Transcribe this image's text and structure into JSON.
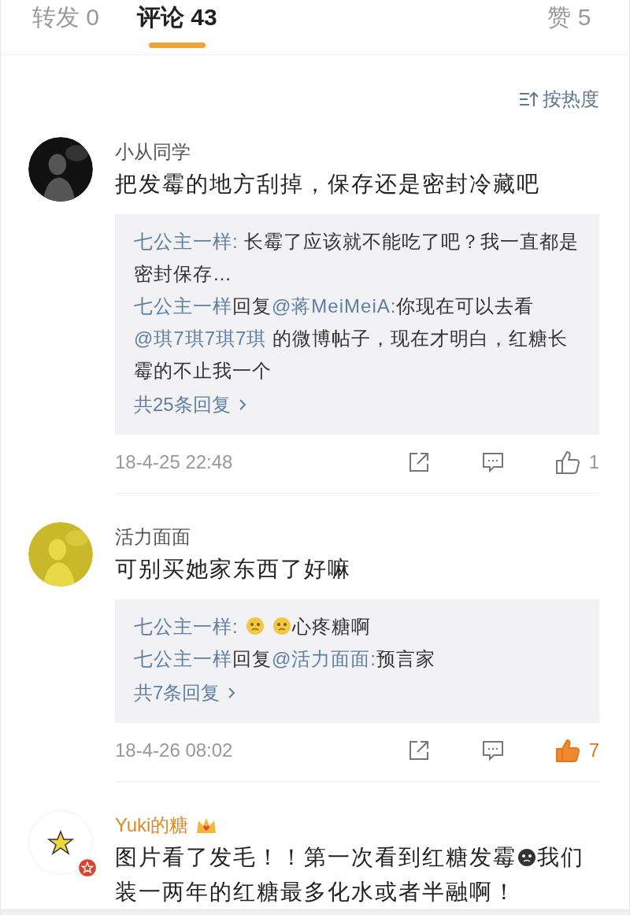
{
  "tabs": [
    {
      "label": "转发 0",
      "selected": false
    },
    {
      "label": "评论 43",
      "selected": true
    },
    {
      "label": "赞 5",
      "selected": false
    }
  ],
  "sort": {
    "label": "按热度"
  },
  "comments": [
    {
      "user": "小从同学",
      "vip": false,
      "avatar": {
        "kind": "picture"
      },
      "text": [
        {
          "kind": "text",
          "text": "把发霉的地方刮掉，保存还是密封冷藏吧"
        }
      ],
      "replies": [
        [
          {
            "kind": "user",
            "text": "七公主一样:"
          },
          {
            "kind": "text",
            "text": " 长霉了应该就不能吃了吧？我一直都是密封保存…"
          }
        ],
        [
          {
            "kind": "user",
            "text": "七公主一样"
          },
          {
            "kind": "text",
            "text": "回复"
          },
          {
            "kind": "user",
            "text": "@蒋MeiMeiA:"
          },
          {
            "kind": "text",
            "text": "你现在可以去看"
          },
          {
            "kind": "user",
            "text": "@琪7琪7琪7琪"
          },
          {
            "kind": "text",
            "text": " 的微博帖子，现在才明白，红糖长霉的不止我一个"
          }
        ]
      ],
      "more_replies": "共25条回复",
      "time": "18-4-25 22:48",
      "likes": "1",
      "liked": false
    },
    {
      "user": "活力面面",
      "vip": false,
      "avatar": {
        "kind": "picture"
      },
      "text": [
        {
          "kind": "text",
          "text": "可别买她家东西了好嘛"
        }
      ],
      "replies": [
        [
          {
            "kind": "user",
            "text": "七公主一样:"
          },
          {
            "kind": "emoji"
          },
          {
            "kind": "emoji"
          },
          {
            "kind": "text",
            "text": "心疼糖啊"
          }
        ],
        [
          {
            "kind": "user",
            "text": "七公主一样"
          },
          {
            "kind": "text",
            "text": "回复"
          },
          {
            "kind": "user",
            "text": "@活力面面:"
          },
          {
            "kind": "text",
            "text": "预言家"
          }
        ]
      ],
      "more_replies": "共7条回复",
      "time": "18-4-26 08:02",
      "likes": "7",
      "liked": true
    },
    {
      "user": "Yuki的糖",
      "vip": true,
      "avatar": {
        "kind": "picture"
      },
      "text": [
        {
          "kind": "text",
          "text": "图片看了发毛！！第一次看到红糖发霉"
        },
        {
          "kind": "emoji"
        },
        {
          "kind": "text",
          "text": "我们装一两年的红糖最多化水或者半融啊！"
        }
      ]
    }
  ]
}
